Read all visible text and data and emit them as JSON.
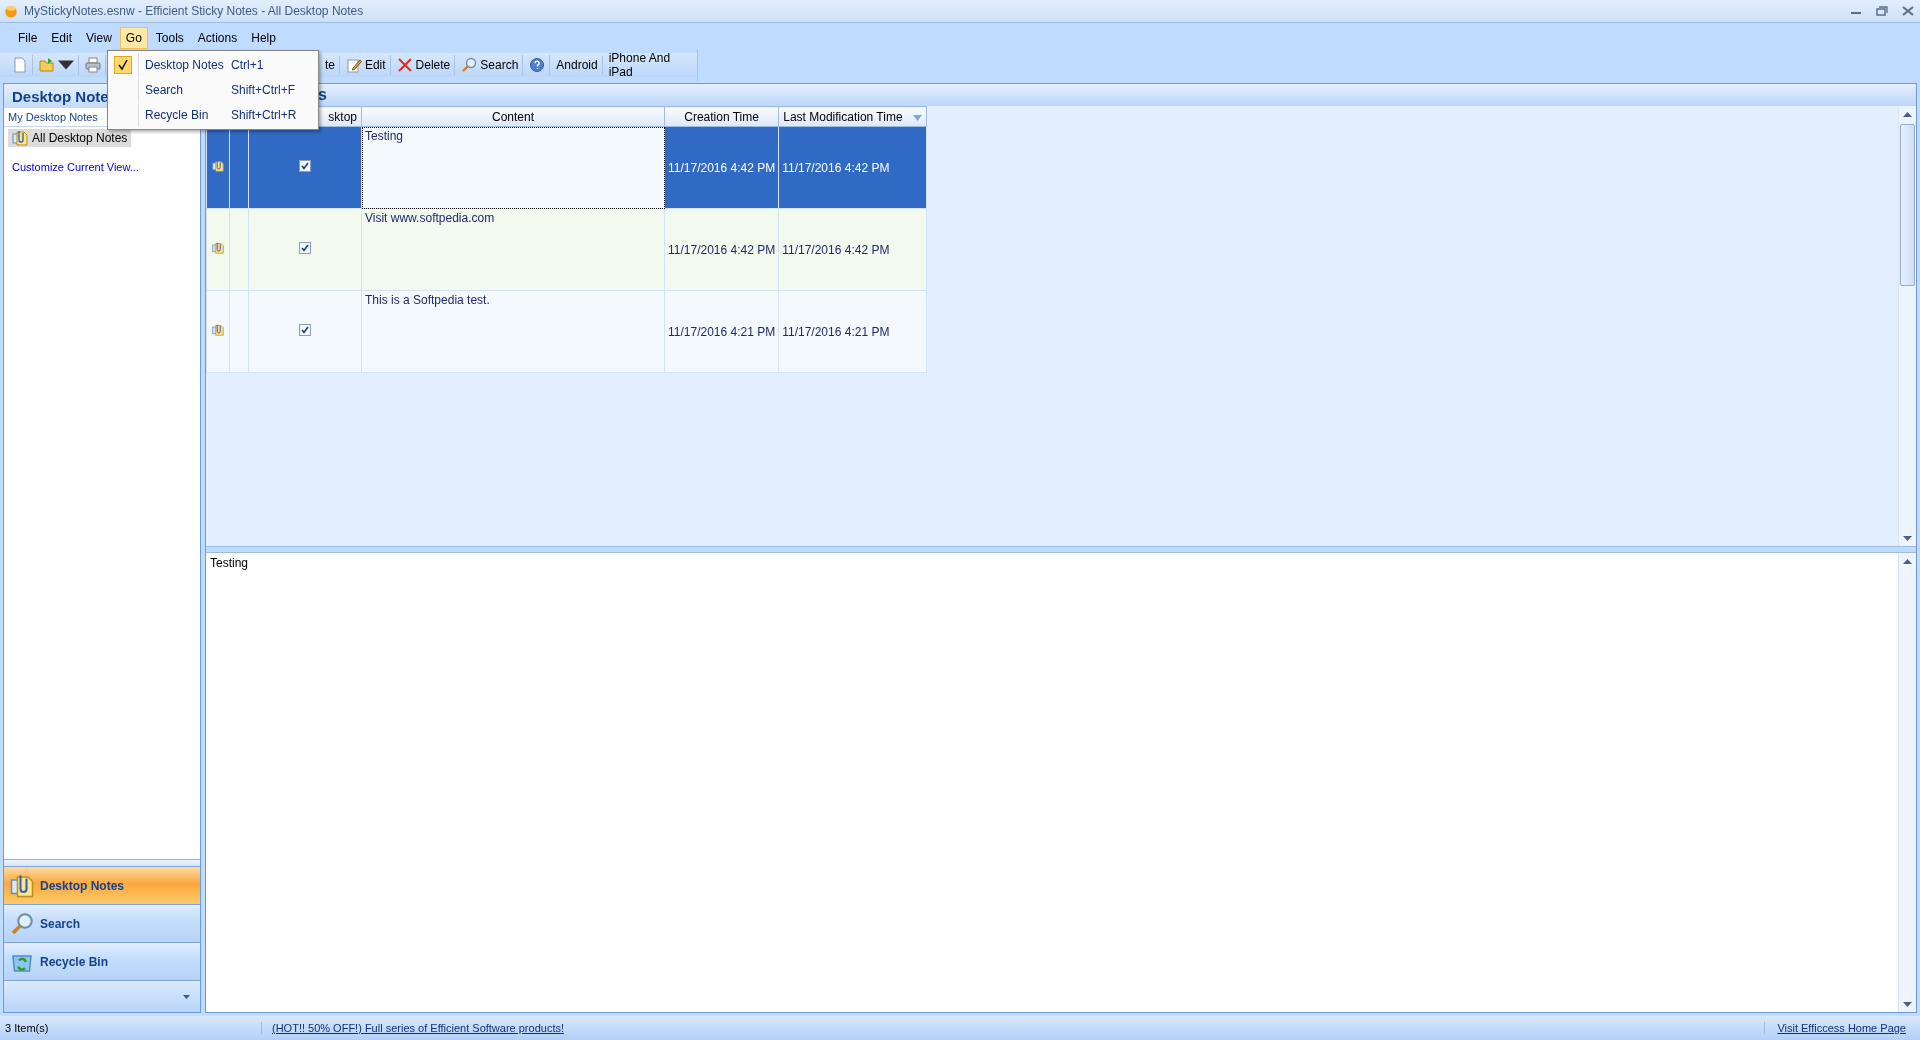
{
  "window": {
    "title": "MyStickyNotes.esnw - Efficient Sticky Notes - All Desktop Notes"
  },
  "menu": [
    {
      "label": "File",
      "open": false
    },
    {
      "label": "Edit",
      "open": false
    },
    {
      "label": "View",
      "open": false
    },
    {
      "label": "Go",
      "open": true
    },
    {
      "label": "Tools",
      "open": false
    },
    {
      "label": "Actions",
      "open": false
    },
    {
      "label": "Help",
      "open": false
    }
  ],
  "go_menu": [
    {
      "label": "Desktop Notes",
      "shortcut": "Ctrl+1",
      "checked": true
    },
    {
      "label": "Search",
      "shortcut": "Shift+Ctrl+F",
      "checked": false
    },
    {
      "label": "Recycle Bin",
      "shortcut": "Shift+Ctrl+R",
      "checked": false
    }
  ],
  "toolbar": [
    {
      "kind": "new"
    },
    {
      "kind": "open"
    },
    {
      "kind": "print"
    },
    {
      "kind": "gap"
    },
    {
      "kind": "text",
      "label": "te"
    },
    {
      "kind": "edit",
      "label": "Edit"
    },
    {
      "kind": "delete",
      "label": "Delete"
    },
    {
      "kind": "search",
      "label": "Search"
    },
    {
      "kind": "help"
    },
    {
      "kind": "text",
      "label": "Android"
    },
    {
      "kind": "text",
      "label": "iPhone And iPad"
    }
  ],
  "sidebar": {
    "title": "Desktop Note",
    "section": "My Desktop Notes",
    "items": [
      {
        "label": "All Desktop Notes",
        "selected": true
      }
    ],
    "link": "Customize Current View..."
  },
  "nav": [
    {
      "kind": "notes",
      "label": "Desktop Notes",
      "selected": true
    },
    {
      "kind": "search",
      "label": "Search",
      "selected": false
    },
    {
      "kind": "recycle",
      "label": "Recycle Bin",
      "selected": false
    }
  ],
  "content": {
    "title": "s",
    "columns": [
      {
        "label": "sktop",
        "sorted": false
      },
      {
        "label": "Content",
        "sorted": false
      },
      {
        "label": "Creation Time",
        "sorted": false
      },
      {
        "label": "Last Modification Time",
        "sorted": true
      }
    ],
    "rows": [
      {
        "on_desktop": true,
        "content": "Testing",
        "created": "11/17/2016 4:42 PM",
        "modified": "11/17/2016 4:42 PM",
        "selected": true
      },
      {
        "on_desktop": true,
        "content": "Visit www.softpedia.com",
        "created": "11/17/2016 4:42 PM",
        "modified": "11/17/2016 4:42 PM",
        "selected": false
      },
      {
        "on_desktop": true,
        "content": "This is a Softpedia test.",
        "created": "11/17/2016 4:21 PM",
        "modified": "11/17/2016 4:21 PM",
        "selected": false
      }
    ],
    "preview": "Testing"
  },
  "status_bar": {
    "count": "3 Item(s)",
    "promo": "(HOT!! 50% OFF!) Full series of Efficient Software products!",
    "link": "Visit Efficcess Home Page"
  }
}
